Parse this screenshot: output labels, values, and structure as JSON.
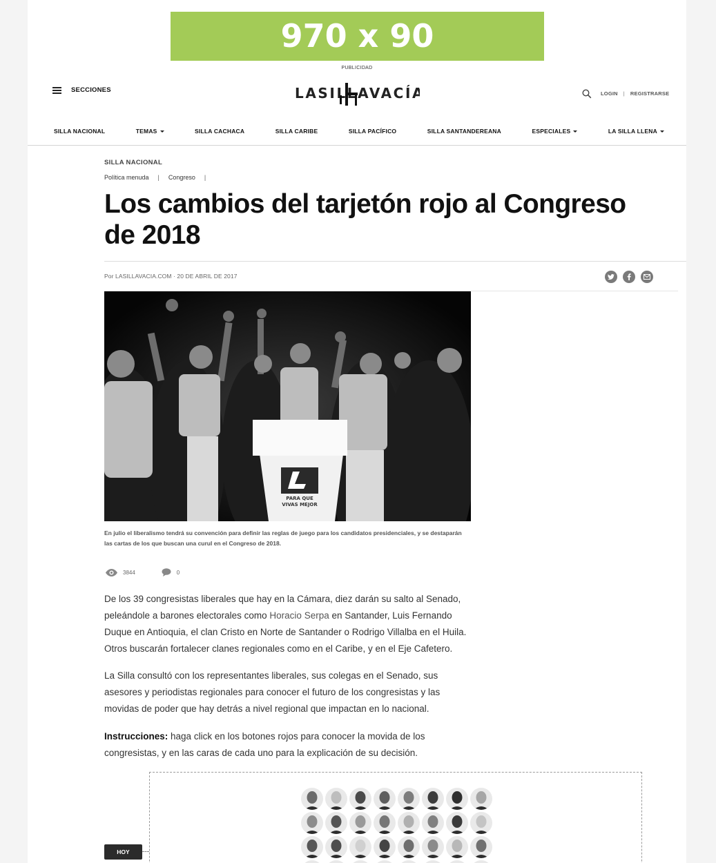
{
  "ad": {
    "size_text": "970 x 90",
    "label": "PUBLICIDAD"
  },
  "header": {
    "menu_label": "SECCIONES",
    "logo_text": "LASILLAVACÍA",
    "login": "LOGIN",
    "separator": "|",
    "register": "REGISTRARSE"
  },
  "nav": {
    "items": [
      {
        "label": "SILLA NACIONAL",
        "dropdown": false
      },
      {
        "label": "TEMAS",
        "dropdown": true
      },
      {
        "label": "SILLA CACHACA",
        "dropdown": false
      },
      {
        "label": "SILLA CARIBE",
        "dropdown": false
      },
      {
        "label": "SILLA PACÍFICO",
        "dropdown": false
      },
      {
        "label": "SILLA SANTANDEREANA",
        "dropdown": false
      },
      {
        "label": "ESPECIALES",
        "dropdown": true
      },
      {
        "label": "LA SILLA LLENA",
        "dropdown": true
      }
    ]
  },
  "article": {
    "section": "SILLA NACIONAL",
    "tags": [
      "Política menuda",
      "Congreso"
    ],
    "tag_separator": "|",
    "title": "Los cambios del tarjetón rojo al Congreso de 2018",
    "byline": "Por LASILLAVACIA.COM · 20 DE ABRIL DE 2017",
    "share_icons": [
      "twitter-icon",
      "facebook-icon",
      "email-icon"
    ],
    "podium_text_1": "PARA QUE",
    "podium_text_2": "VIVAS MEJOR",
    "caption": "En julio el liberalismo tendrá su convención para definir las reglas de juego para los candidatos presidenciales, y se destaparán las cartas de los que buscan una curul en el Congreso de 2018.",
    "views": "3844",
    "comments": "0",
    "p1_a": "De los 39 congresistas liberales que hay en la Cámara, diez darán su salto al Senado, peleándole a barones electorales como ",
    "p1_link": "Horacio Serpa",
    "p1_b": " en Santander, Luis Fernando Duque en Antioquia, el clan Cristo en Norte de Santander o Rodrigo Villalba en el Huila. Otros buscarán fortalecer clanes regionales como en el Caribe, y en el Eje Cafetero.",
    "p2": "La Silla consultó con los representantes liberales, sus colegas en el Senado, sus asesores y periodistas regionales para conocer el futuro de los congresistas y las movidas de poder que hay detrás a nivel regional que impactan en lo nacional.",
    "p3_strong": "Instrucciones:",
    "p3": " haga click en los botones rojos para conocer la movida de los congresistas, y en las caras de cada uno para la explicación de su decisión."
  },
  "interactive": {
    "hoy_label": "HOY",
    "face_shades": [
      "#6b6b6b",
      "#bdbdbd",
      "#4a4a4a",
      "#5e5e5e",
      "#7c7c7c",
      "#3d3d3d",
      "#2f2f2f",
      "#a6a6a6",
      "#8c8c8c",
      "#555555",
      "#9a9a9a",
      "#767676",
      "#b0b0b0",
      "#808080",
      "#3a3a3a",
      "#c4c4c4",
      "#575757",
      "#4d4d4d",
      "#d0d0d0",
      "#444444",
      "#6e6e6e",
      "#8a8a8a",
      "#b8b8b8",
      "#707070",
      "#363636",
      "#5a5a5a",
      "#9e9e9e",
      "#484848",
      "#7a7a7a",
      "#3f3f3f",
      "#8f8f8f",
      "#626262"
    ]
  }
}
